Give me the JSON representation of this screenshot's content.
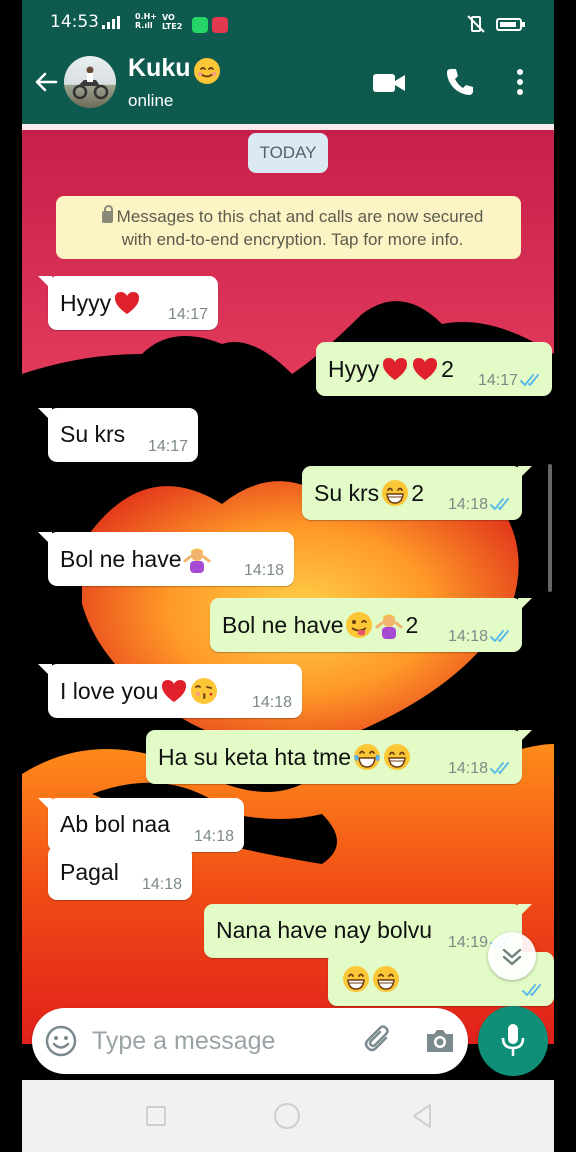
{
  "status_bar": {
    "time": "14:53",
    "network_label": "0.H+\nR.ıll",
    "volte_label": "VO\nLTE2"
  },
  "app_bar": {
    "contact_name": "Kuku",
    "contact_status": "online",
    "icons": [
      "back-arrow-icon",
      "video-call-icon",
      "voice-call-icon",
      "more-vert-icon"
    ]
  },
  "chat": {
    "date_chip": "TODAY",
    "encryption_notice_line1": "Messages to this chat and calls are now secured",
    "encryption_notice_line2": "with end-to-end encryption. Tap for more info.",
    "messages": [
      {
        "dir": "in",
        "text": "Hyyy",
        "emojis": [
          "red-heart"
        ],
        "time": "14:17"
      },
      {
        "dir": "out",
        "text": "Hyyy",
        "emojis": [
          "red-heart",
          "red-heart"
        ],
        "suffix": "2",
        "time": "14:17",
        "status": "read"
      },
      {
        "dir": "in",
        "text": "Su krs",
        "emojis": [],
        "time": "14:17"
      },
      {
        "dir": "out",
        "text": "Su krs",
        "emojis": [
          "grinning-face"
        ],
        "suffix": "2",
        "time": "14:18",
        "status": "read"
      },
      {
        "dir": "in",
        "text": "Bol ne have",
        "emojis": [
          "person-shrugging"
        ],
        "time": "14:18"
      },
      {
        "dir": "out",
        "text": "Bol ne have",
        "emojis": [
          "tongue-face",
          "person-shrugging"
        ],
        "suffix": "2",
        "time": "14:18",
        "status": "read"
      },
      {
        "dir": "in",
        "text": "I love you",
        "emojis": [
          "red-heart",
          "kissing-face"
        ],
        "time": "14:18"
      },
      {
        "dir": "out",
        "text": "Ha su keta hta tme",
        "emojis": [
          "tears-of-joy",
          "grinning-face"
        ],
        "time": "14:18",
        "status": "read"
      },
      {
        "dir": "in",
        "text": "Ab bol naa",
        "emojis": [],
        "time": "14:18"
      },
      {
        "dir": "in",
        "text": "Pagal",
        "emojis": [],
        "time": "14:18"
      },
      {
        "dir": "out",
        "text": "Nana have nay bolvu",
        "emojis": [],
        "time": "14:19",
        "status": "read"
      },
      {
        "dir": "out",
        "text": "",
        "emojis": [
          "grinning-face",
          "grinning-face"
        ],
        "time": "",
        "status": "read"
      }
    ]
  },
  "composer": {
    "placeholder": "Type a message",
    "icons": [
      "emoji-icon",
      "attach-icon",
      "camera-icon",
      "mic-icon"
    ]
  },
  "colors": {
    "header_green": "#0e5a4f",
    "outgoing_bubble": "#e2fbc7",
    "incoming_bubble": "#ffffff",
    "read_ticks": "#4fb6ec",
    "mic_button": "#0f8f78"
  }
}
